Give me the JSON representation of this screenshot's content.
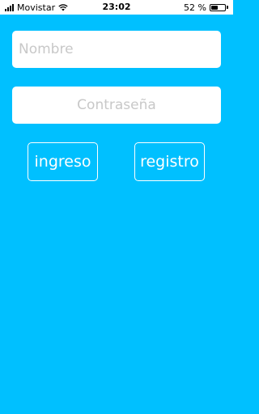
{
  "status_bar": {
    "carrier": "Movistar",
    "time": "23:02",
    "battery": "52 %",
    "battery_level": 0.52,
    "signal_icon": "signal-bars-icon",
    "wifi_icon": "wifi-icon",
    "battery_icon": "battery-icon"
  },
  "form": {
    "name_placeholder": "Nombre",
    "name_value": "",
    "password_placeholder": "Contraseña",
    "password_value": "",
    "login_label": "ingreso",
    "register_label": "registro"
  },
  "colors": {
    "background": "#00C0FF",
    "field_bg": "#FFFFFF",
    "button_border": "#FFFFFF"
  }
}
